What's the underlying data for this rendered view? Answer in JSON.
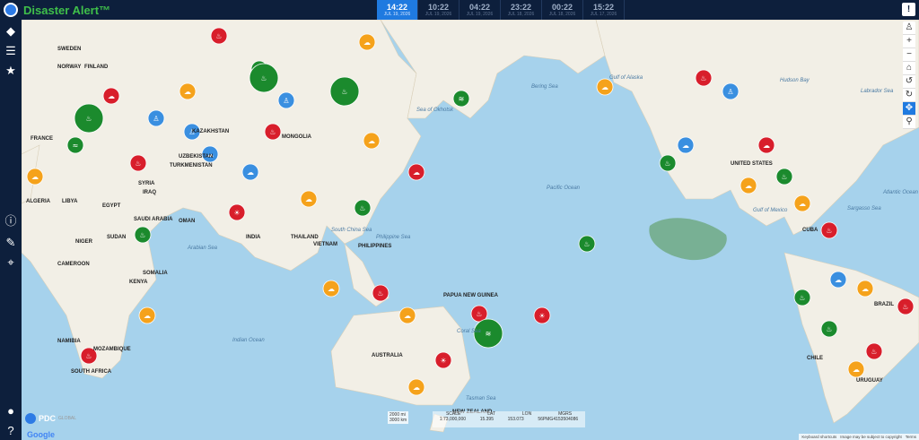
{
  "app": {
    "title": "Disaster Alert™"
  },
  "timeline": [
    {
      "time": "14:22",
      "date": "JUL 19, 2026",
      "active": true
    },
    {
      "time": "10:22",
      "date": "JUL 19, 2026",
      "active": false
    },
    {
      "time": "04:22",
      "date": "JUL 19, 2026",
      "active": false
    },
    {
      "time": "23:22",
      "date": "JUL 18, 2026",
      "active": false
    },
    {
      "time": "00:22",
      "date": "JUL 18, 2026",
      "active": false
    },
    {
      "time": "15:22",
      "date": "JUL 17, 2026",
      "active": false
    }
  ],
  "labels": {
    "countries": [
      {
        "t": "SWEDEN"
      },
      {
        "t": "FINLAND"
      },
      {
        "t": "NORWAY"
      },
      {
        "t": "FRANCE"
      },
      {
        "t": "ALGERIA"
      },
      {
        "t": "LIBYA"
      },
      {
        "t": "EGYPT"
      },
      {
        "t": "SYRIA"
      },
      {
        "t": "IRAQ"
      },
      {
        "t": "SAUDI ARABIA"
      },
      {
        "t": "OMAN"
      },
      {
        "t": "TURKMENISTAN"
      },
      {
        "t": "UZBEKISTAN"
      },
      {
        "t": "KAZAKHSTAN"
      },
      {
        "t": "MONGOLIA"
      },
      {
        "t": "INDIA"
      },
      {
        "t": "THAILAND"
      },
      {
        "t": "VIETNAM"
      },
      {
        "t": "PHILIPPINES"
      },
      {
        "t": "PAPUA NEW GUINEA"
      },
      {
        "t": "AUSTRALIA"
      },
      {
        "t": "NEW ZEALAND"
      },
      {
        "t": "SUDAN"
      },
      {
        "t": "NIGER"
      },
      {
        "t": "CAMEROON"
      },
      {
        "t": "KENYA"
      },
      {
        "t": "SOMALIA"
      },
      {
        "t": "NAMIBIA"
      },
      {
        "t": "MOZAMBIQUE"
      },
      {
        "t": "SOUTH AFRICA"
      },
      {
        "t": "UNITED STATES"
      },
      {
        "t": "CHILE"
      },
      {
        "t": "BRAZIL"
      },
      {
        "t": "URUGUAY"
      },
      {
        "t": "CUBA"
      }
    ],
    "seas": [
      {
        "t": "Sea of Okhotsk"
      },
      {
        "t": "Bering Sea"
      },
      {
        "t": "Gulf of Alaska"
      },
      {
        "t": "Hudson Bay"
      },
      {
        "t": "Labrador Sea"
      },
      {
        "t": "Pacific Ocean"
      },
      {
        "t": "Atlantic Ocean"
      },
      {
        "t": "Sargasso Sea"
      },
      {
        "t": "Gulf of Mexico"
      },
      {
        "t": "Philippine Sea"
      },
      {
        "t": "South China Sea"
      },
      {
        "t": "Arabian Sea"
      },
      {
        "t": "Indian Ocean"
      },
      {
        "t": "Coral Sea"
      },
      {
        "t": "Tasman Sea"
      }
    ]
  },
  "colors": {
    "red": "#d81e2b",
    "green": "#1b8a2d",
    "orange": "#f5a21b",
    "blue": "#3a8fe0",
    "land": "#f2efe6",
    "water": "#a6d2ec"
  },
  "markers": [
    {
      "c": "red",
      "icon": "fire"
    },
    {
      "c": "green",
      "icon": "fire"
    },
    {
      "c": "orange",
      "icon": "storm"
    },
    {
      "c": "blue",
      "icon": "person"
    },
    {
      "c": "red",
      "icon": "storm"
    },
    {
      "c": "green",
      "icon": "flood"
    },
    {
      "c": "orange",
      "icon": "storm"
    },
    {
      "c": "red",
      "icon": "fire"
    },
    {
      "c": "green",
      "icon": "fire"
    },
    {
      "c": "blue",
      "icon": "storm"
    },
    {
      "c": "orange",
      "icon": "storm"
    },
    {
      "c": "red",
      "icon": "heat"
    },
    {
      "c": "green",
      "icon": "fire"
    },
    {
      "c": "orange",
      "icon": "storm"
    },
    {
      "c": "red",
      "icon": "fire"
    },
    {
      "c": "blue",
      "icon": "person"
    },
    {
      "c": "green",
      "icon": "fire"
    },
    {
      "c": "orange",
      "icon": "storm"
    },
    {
      "c": "red",
      "icon": "storm"
    },
    {
      "c": "green",
      "icon": "fire"
    },
    {
      "c": "red",
      "icon": "fire"
    },
    {
      "c": "orange",
      "icon": "storm"
    },
    {
      "c": "blue",
      "icon": "storm"
    },
    {
      "c": "green",
      "icon": "quake"
    },
    {
      "c": "red",
      "icon": "fire"
    },
    {
      "c": "orange",
      "icon": "storm"
    },
    {
      "c": "red",
      "icon": "heat"
    },
    {
      "c": "green",
      "icon": "fire"
    },
    {
      "c": "orange",
      "icon": "storm"
    },
    {
      "c": "red",
      "icon": "fire"
    },
    {
      "c": "blue",
      "icon": "person"
    },
    {
      "c": "green",
      "icon": "fire"
    },
    {
      "c": "orange",
      "icon": "storm"
    },
    {
      "c": "red",
      "icon": "storm"
    },
    {
      "c": "green",
      "icon": "fire"
    },
    {
      "c": "orange",
      "icon": "storm"
    },
    {
      "c": "red",
      "icon": "fire"
    },
    {
      "c": "blue",
      "icon": "storm"
    },
    {
      "c": "green",
      "icon": "fire"
    },
    {
      "c": "orange",
      "icon": "storm"
    },
    {
      "c": "red",
      "icon": "fire"
    },
    {
      "c": "green",
      "icon": "fire"
    },
    {
      "c": "orange",
      "icon": "storm"
    },
    {
      "c": "red",
      "icon": "fire"
    },
    {
      "c": "blue",
      "icon": "person"
    },
    {
      "c": "green",
      "icon": "fire"
    },
    {
      "c": "orange",
      "icon": "storm"
    },
    {
      "c": "red",
      "icon": "fire"
    },
    {
      "c": "green",
      "icon": "quake"
    },
    {
      "c": "orange",
      "icon": "storm"
    },
    {
      "c": "red",
      "icon": "heat"
    },
    {
      "c": "blue",
      "icon": "storm"
    }
  ],
  "bottom": {
    "pdc": "PDC",
    "pdc_sub": "GLOBAL",
    "google": "Google",
    "scale_top": "2000 mi",
    "scale_bottom": "3000 km",
    "coord_headers": [
      "SCALE",
      "LAT",
      "LON",
      "MGRS"
    ],
    "coord_values": [
      "1:73,000,000",
      "15.395",
      "153.073",
      "56PMG4153504086"
    ],
    "attr": [
      "Keyboard shortcuts",
      "Image may be subject to copyright",
      "Terms"
    ]
  }
}
